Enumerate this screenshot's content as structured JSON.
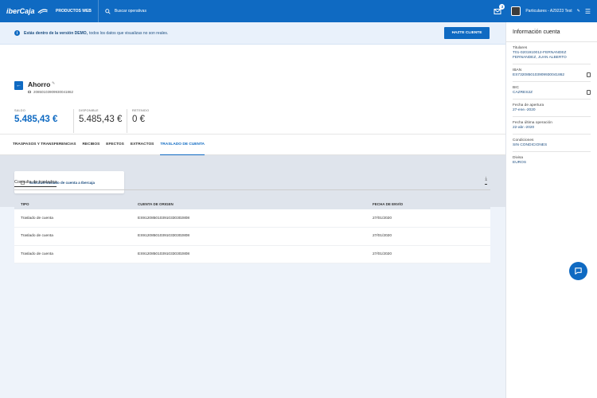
{
  "header": {
    "logo": "iberCaja",
    "productos": "PRODUCTOS WEB",
    "search_placeholder": "Buscar operativas",
    "notif_count": "3",
    "user": "Particulares - A29223 Test"
  },
  "demo": {
    "bold": "Estás dentro de la versión DEMO,",
    "text": "todos los datos que visualizas no son reales.",
    "button": "HAZTE CLIENTE"
  },
  "account": {
    "name": "Ahorro",
    "number": "20850103909930041862",
    "balances": [
      {
        "label": "SALDO",
        "value": "5.485,43 €"
      },
      {
        "label": "DISPONIBLE",
        "value": "5.485,43 €"
      },
      {
        "label": "RETENIDO",
        "value": "0 €"
      }
    ]
  },
  "tabs": [
    "TRASPASOS Y TRANSFERENCIAS",
    "RECIBOS",
    "EFECTOS",
    "EXTRACTOS",
    "TRASLADO DE CUENTA"
  ],
  "card": {
    "label": "Solicitud traslado de cuenta a Ibercaja"
  },
  "consulta": {
    "title": "Consulta de traslados",
    "columns": [
      "TIPO",
      "CUENTA DE ORIGEN",
      "FECHA DE ENVÍO"
    ],
    "rows": [
      [
        "Traslado de cuenta",
        "ES9120850103910330302808",
        "27/01/2020"
      ],
      [
        "Traslado de cuenta",
        "ES9120850103910330302808",
        "27/01/2020"
      ],
      [
        "Traslado de cuenta",
        "ES9120850103910330302808",
        "27/01/2020"
      ]
    ]
  },
  "side": {
    "title": "Información cuenta",
    "fields": [
      {
        "k": "Titulares",
        "v": "T01-0201910012-FERNANDEZ FERNANDEZ, JUAN ALBERTO"
      },
      {
        "k": "IBAN",
        "v": "ES7320850103909930041862"
      },
      {
        "k": "BIC",
        "v": "CAZRES2Z"
      },
      {
        "k": "Fecha de apertura",
        "v": "27-ene.-2020"
      },
      {
        "k": "Fecha última operación",
        "v": "22-abr.-2020"
      },
      {
        "k": "Condiciones",
        "v": "SIN CONDICIONES"
      },
      {
        "k": "Divisa",
        "v": "EUROS"
      }
    ]
  },
  "colors": {
    "brand": "#0f6ac2",
    "bg": "#eef3fa"
  }
}
